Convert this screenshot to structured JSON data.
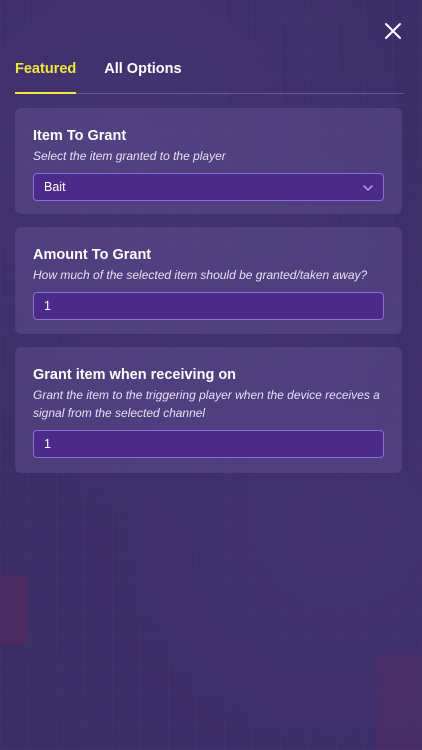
{
  "close_icon": "close-icon",
  "tabs": [
    {
      "label": "Featured",
      "active": true
    },
    {
      "label": "All Options",
      "active": false
    }
  ],
  "settings": [
    {
      "title": "Item To Grant",
      "description": "Select the item granted to the player",
      "value": "Bait",
      "control": "dropdown"
    },
    {
      "title": "Amount To Grant",
      "description": "How much of the selected item should be granted/taken away?",
      "value": "1",
      "control": "input"
    },
    {
      "title": "Grant item when receiving on",
      "description": "Grant the item to the triggering player when the device receives a signal from the selected channel",
      "value": "1",
      "control": "input"
    }
  ],
  "colors": {
    "accent": "#f2e63c",
    "field_bg": "#4b2a8a",
    "field_border": "#8a6ed8",
    "background": "#3b2d66"
  }
}
